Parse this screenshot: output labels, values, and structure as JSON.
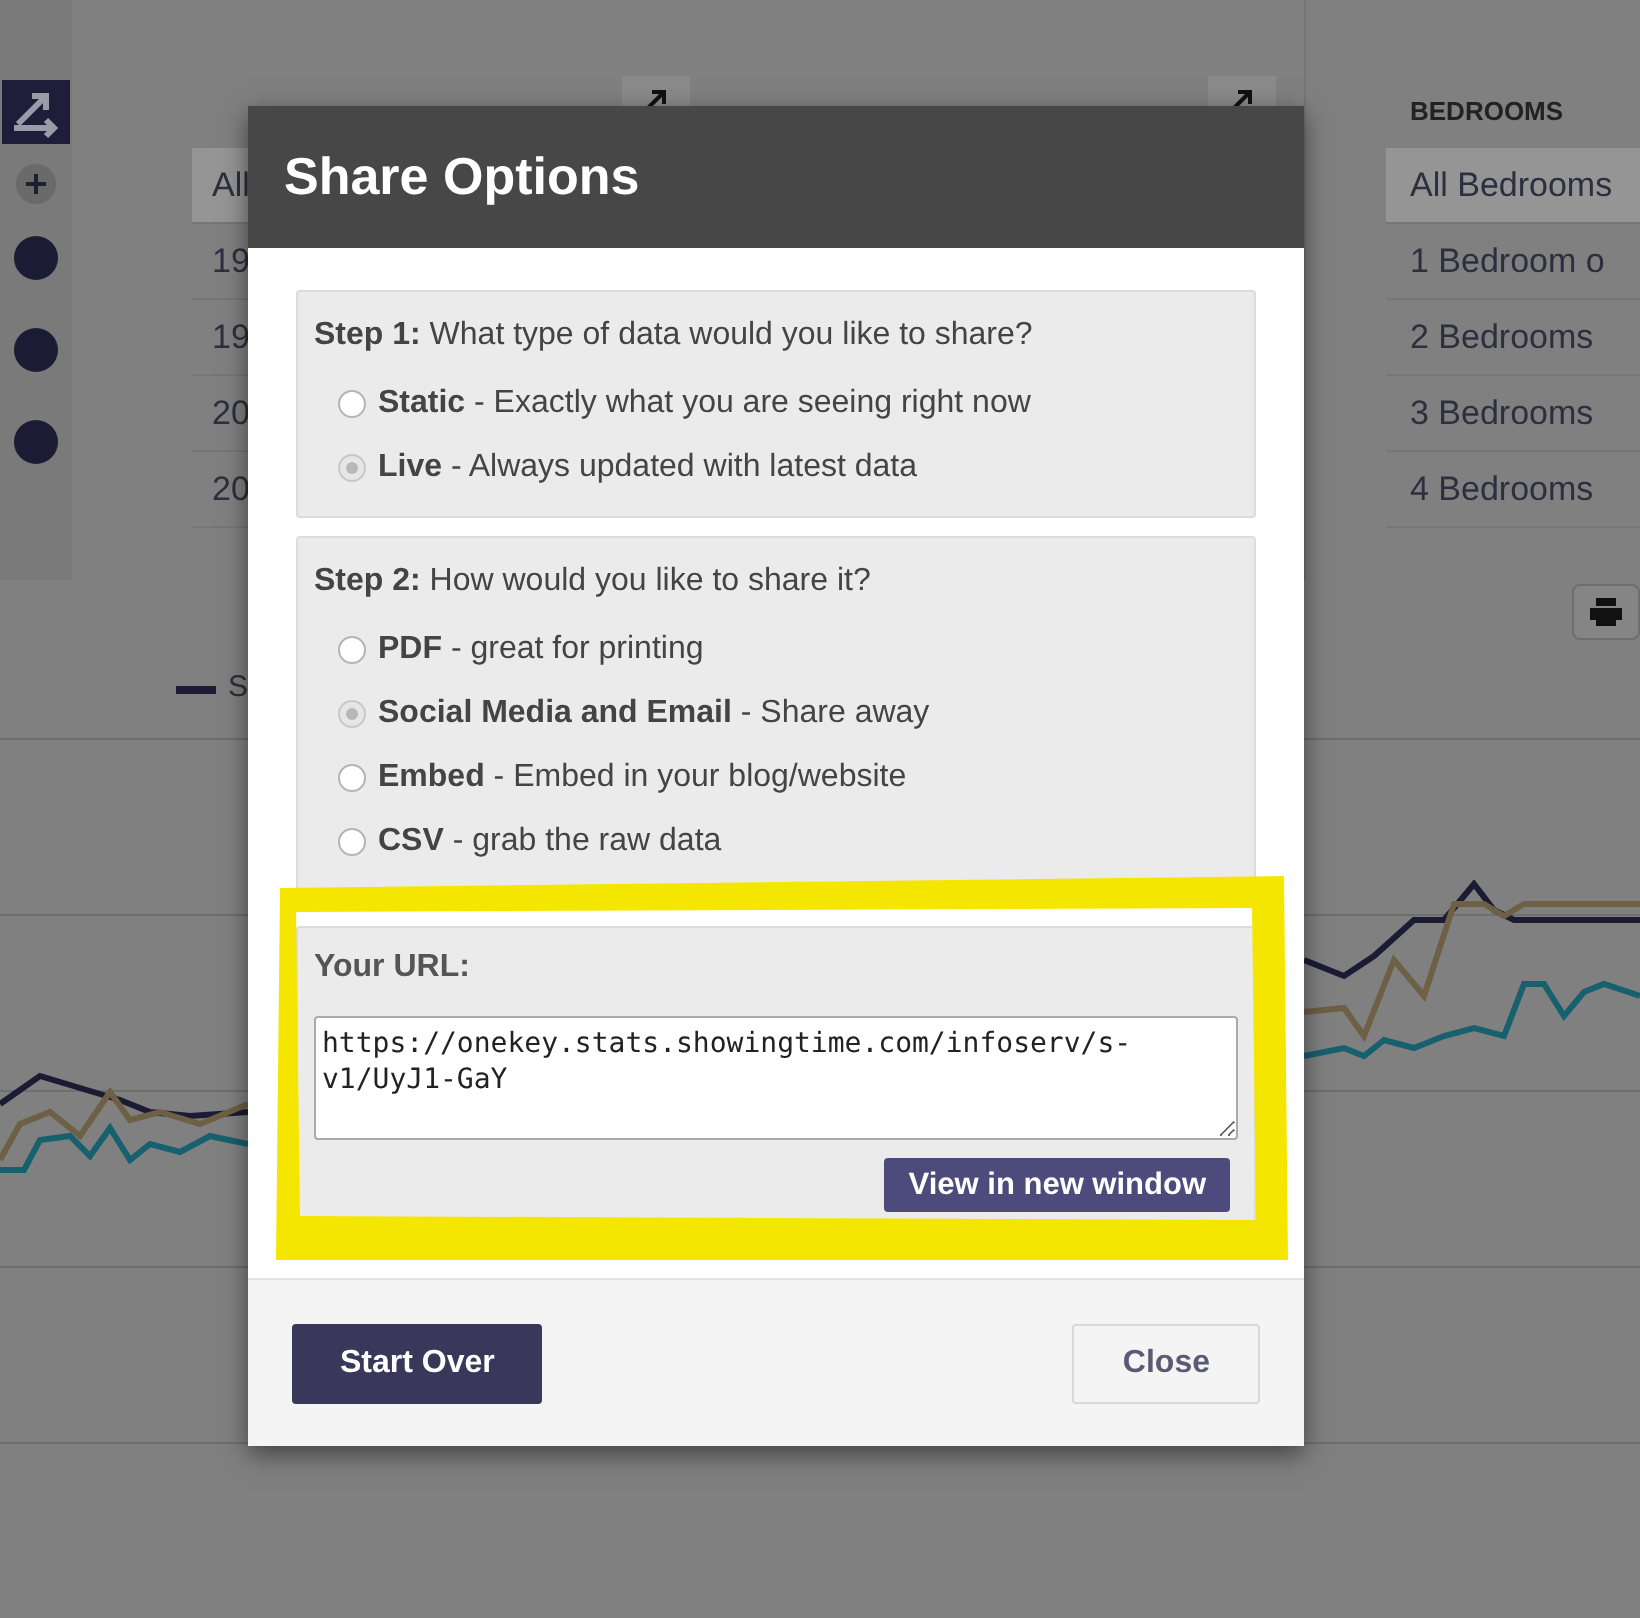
{
  "background": {
    "year_column": {
      "rows": [
        {
          "text": "All",
          "selected": true
        },
        {
          "text": "19",
          "selected": false
        },
        {
          "text": "19",
          "selected": false
        },
        {
          "text": "20",
          "selected": false
        },
        {
          "text": "20",
          "selected": false
        }
      ]
    },
    "bedrooms_column": {
      "header": "BEDROOMS",
      "rows": [
        {
          "text": "All Bedrooms",
          "selected": true
        },
        {
          "text": "1 Bedroom o",
          "selected": false
        },
        {
          "text": "2 Bedrooms",
          "selected": false
        },
        {
          "text": "3 Bedrooms",
          "selected": false
        },
        {
          "text": "4 Bedrooms",
          "selected": false
        }
      ]
    },
    "legend": {
      "label": "S"
    }
  },
  "dialog": {
    "title": "Share Options",
    "steps": [
      {
        "label": "Step 1:",
        "question": "What type of data would you like to share?",
        "options": [
          {
            "name": "Static",
            "description": "- Exactly what you are seeing right now",
            "selected": false
          },
          {
            "name": "Live",
            "description": "- Always updated with latest data",
            "selected": true
          }
        ]
      },
      {
        "label": "Step 2:",
        "question": "How would you like to share it?",
        "options": [
          {
            "name": "PDF",
            "description": "- great for printing",
            "selected": false
          },
          {
            "name": "Social Media and Email",
            "description": "- Share away",
            "selected": true
          },
          {
            "name": "Embed",
            "description": "- Embed in your blog/website",
            "selected": false
          },
          {
            "name": "CSV",
            "description": "- grab the raw data",
            "selected": false
          }
        ]
      }
    ],
    "url_section": {
      "label": "Your URL:",
      "value": "https://onekey.stats.showingtime.com/infoserv/s-v1/UyJ1-GaY",
      "button": "View in new window"
    },
    "footer_buttons": [
      {
        "label": "Start Over",
        "kind": "primary"
      },
      {
        "label": "Close",
        "kind": "secondary"
      }
    ]
  }
}
